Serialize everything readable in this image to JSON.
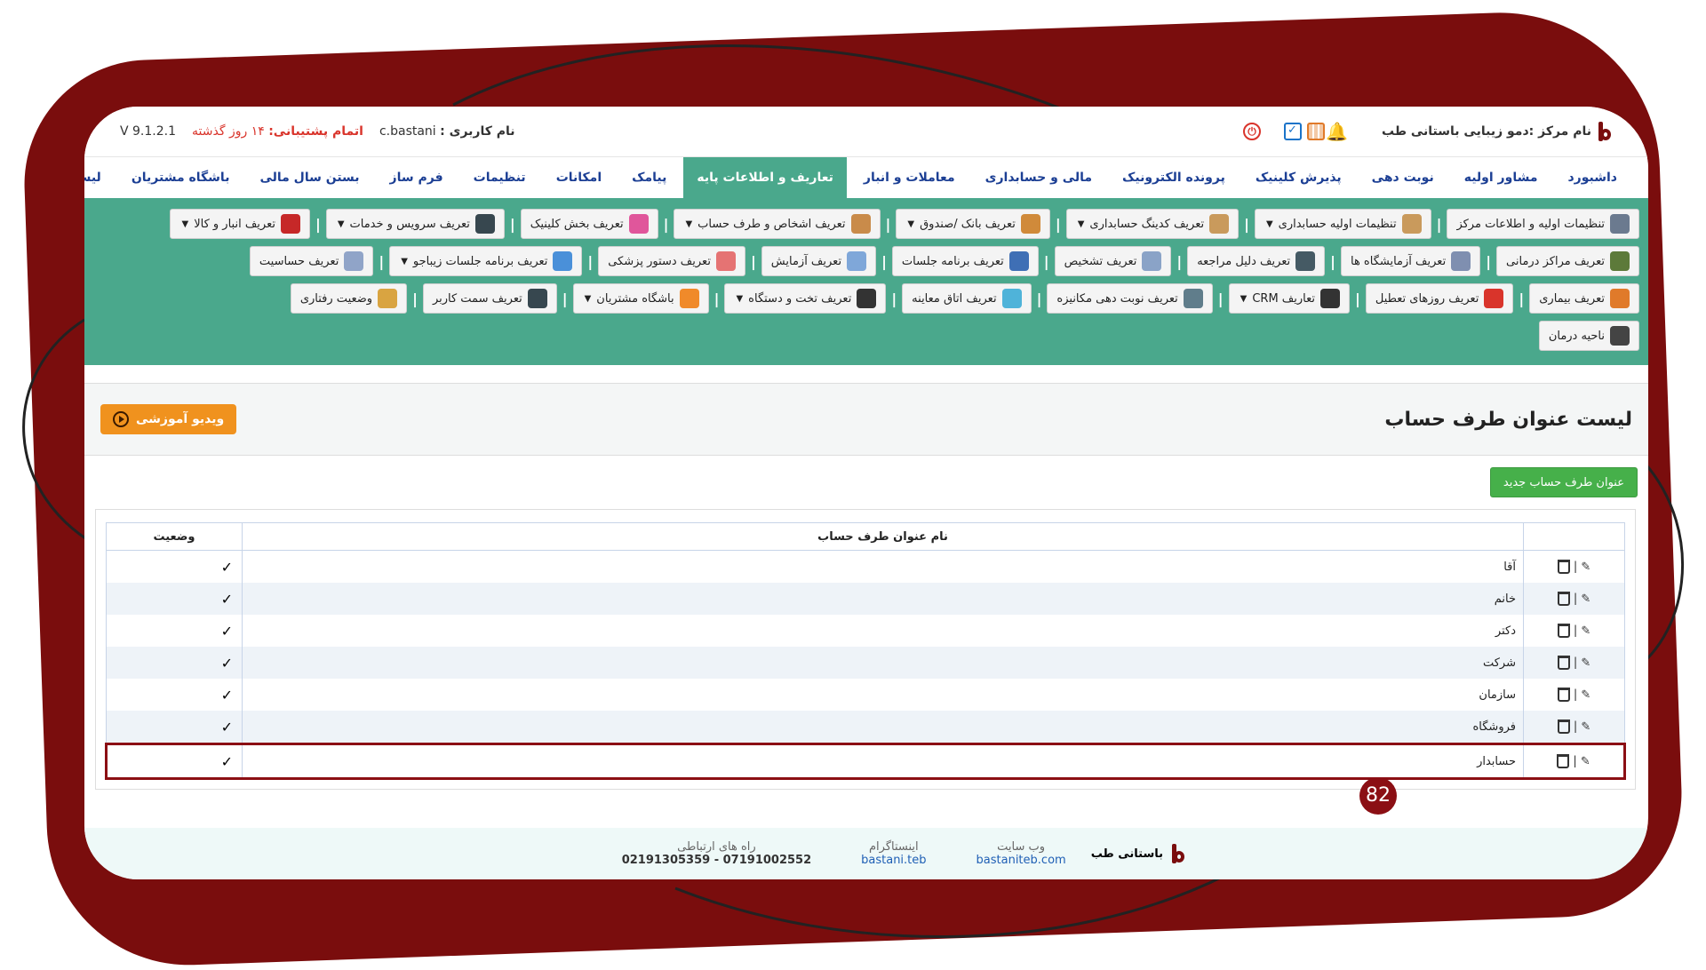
{
  "header": {
    "center_name_label": "نام مرکز :دمو زیبایی باستانی طب",
    "username_label": "نام کاربری :",
    "username": "c.bastani",
    "support_label": "اتمام پشتیبانی:",
    "support_value": "۱۴ روز گذشته",
    "version": "V 9.1.2.1"
  },
  "nav": {
    "tabs": [
      {
        "label": "داشبورد"
      },
      {
        "label": "مشاور اولیه"
      },
      {
        "label": "نوبت دهی"
      },
      {
        "label": "پذیرش کلینیک"
      },
      {
        "label": "پرونده الکترونیک"
      },
      {
        "label": "مالی و حسابداری"
      },
      {
        "label": "معاملات و انبار"
      },
      {
        "label": "تعاریف و اطلاعات پایه"
      },
      {
        "label": "پیامک"
      },
      {
        "label": "امکانات"
      },
      {
        "label": "تنظیمات"
      },
      {
        "label": "فرم ساز"
      },
      {
        "label": "بستن سال مالی"
      },
      {
        "label": "باشگاه مشتریان"
      },
      {
        "label": "لیست ماژول ها"
      }
    ],
    "active_index": 7
  },
  "submenu": {
    "rows": [
      [
        {
          "label": "تنظیمات اولیه و اطلاعات مرکز",
          "color": "#6b7a8f"
        },
        {
          "label": "تنظیمات اولیه حسابداری",
          "color": "#c99a5c",
          "caret": true
        },
        {
          "label": "تعریف کدینگ حسابداری",
          "color": "#c99a5c",
          "caret": true
        },
        {
          "label": "تعریف بانک /صندوق",
          "color": "#d08a3a",
          "caret": true
        },
        {
          "label": "تعریف اشخاص و طرف حساب",
          "color": "#c98b4a",
          "caret": true
        },
        {
          "label": "تعریف بخش کلینیک",
          "color": "#e0569b"
        },
        {
          "label": "تعریف سرویس و خدمات",
          "color": "#37474f",
          "caret": true
        },
        {
          "label": "تعریف انبار و کالا",
          "color": "#c62828",
          "caret": true
        }
      ],
      [
        {
          "label": "تعریف مراکز درمانی",
          "color": "#5d7a3a"
        },
        {
          "label": "تعریف آزمایشگاه ها",
          "color": "#7f8fb0"
        },
        {
          "label": "تعریف دلیل مراجعه",
          "color": "#455a64"
        },
        {
          "label": "تعریف تشخیص",
          "color": "#8aa3c7"
        },
        {
          "label": "تعریف برنامه جلسات",
          "color": "#3f6fb5"
        },
        {
          "label": "تعریف آزمایش",
          "color": "#7fa7d9"
        },
        {
          "label": "تعریف دستور پزشکی",
          "color": "#e57373"
        },
        {
          "label": "تعریف برنامه جلسات زیباجو",
          "color": "#4a90d9",
          "caret": true
        },
        {
          "label": "تعریف حساسیت",
          "color": "#90a4c8"
        }
      ],
      [
        {
          "label": "تعریف بیماری",
          "color": "#e07a2a"
        },
        {
          "label": "تعریف روزهای تعطیل",
          "color": "#d9342b"
        },
        {
          "label": "تعاریف CRM",
          "color": "#333333",
          "caret": true
        },
        {
          "label": "تعریف نوبت دهی مکانیزه",
          "color": "#607d8b"
        },
        {
          "label": "تعریف اتاق معاینه",
          "color": "#4fb3d9"
        },
        {
          "label": "تعریف تخت و دستگاه",
          "color": "#333333",
          "caret": true
        },
        {
          "label": "باشگاه مشتریان",
          "color": "#f08a2a",
          "caret": true
        },
        {
          "label": "تعریف سمت کاربر",
          "color": "#37474f"
        },
        {
          "label": "وضعیت رفتاری",
          "color": "#d9a441"
        }
      ],
      [
        {
          "label": "ناحیه درمان",
          "color": "#444444"
        }
      ]
    ]
  },
  "page": {
    "title": "لیست عنوان طرف حساب",
    "video_button": "ویدیو آموزشی",
    "new_button": "عنوان طرف حساب جدید"
  },
  "table": {
    "headers": [
      "",
      "نام عنوان طرف حساب",
      "وضعیت"
    ],
    "rows": [
      {
        "name": "آقا",
        "status": "✓"
      },
      {
        "name": "خانم",
        "status": "✓"
      },
      {
        "name": "دکتر",
        "status": "✓"
      },
      {
        "name": "شرکت",
        "status": "✓"
      },
      {
        "name": "سازمان",
        "status": "✓"
      },
      {
        "name": "فروشگاه",
        "status": "✓"
      },
      {
        "name": "حسابدار",
        "status": "✓"
      }
    ],
    "highlight_index": 6
  },
  "badge": "82",
  "footer": {
    "brand": "باستانی طب",
    "website_label": "وب سایت",
    "website": "bastaniteb.com",
    "instagram_label": "اینستاگرام",
    "instagram": "bastani.teb",
    "contact_label": "راه های ارتباطی",
    "contact": "07191002552 - 02191305359"
  },
  "colors": {
    "brand": "#7a0d0d",
    "accent": "#4aa88c",
    "nav_text": "#1c3f94"
  }
}
